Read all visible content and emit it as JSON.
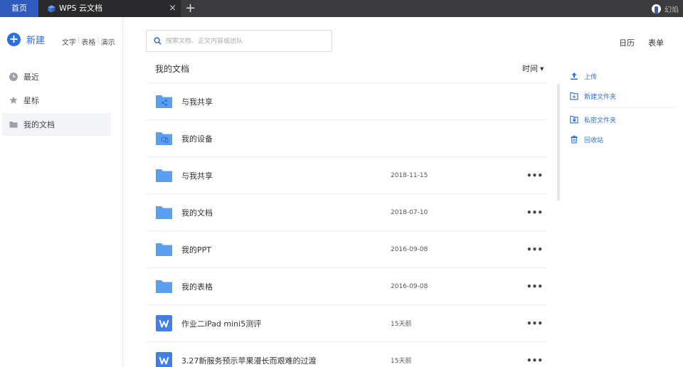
{
  "tabs": {
    "home": "首页",
    "doc": "WPS 云文档",
    "close": "×",
    "add": "+"
  },
  "user": {
    "name": "幻焰"
  },
  "sidebar": {
    "new_label": "新建",
    "quick": [
      "文字",
      "表格",
      "演示"
    ],
    "items": [
      {
        "label": "最近",
        "icon": "clock-icon"
      },
      {
        "label": "星标",
        "icon": "star-icon"
      },
      {
        "label": "我的文档",
        "icon": "folder-icon",
        "active": true
      }
    ]
  },
  "search": {
    "placeholder": "搜索文档、正文内容或团队"
  },
  "header_links": {
    "calendar": "日历",
    "form": "表单"
  },
  "main": {
    "title": "我的文档",
    "sort_label": "时间",
    "files": [
      {
        "name": "与我共享",
        "date": "",
        "type": "shared-folder",
        "more": ""
      },
      {
        "name": "我的设备",
        "date": "",
        "type": "device-folder",
        "more": ""
      },
      {
        "name": "与我共享",
        "date": "2018-11-15",
        "type": "folder",
        "more": "•••"
      },
      {
        "name": "我的文档",
        "date": "2018-07-10",
        "type": "folder",
        "more": "•••"
      },
      {
        "name": "我的PPT",
        "date": "2016-09-08",
        "type": "folder",
        "more": "•••"
      },
      {
        "name": "我的表格",
        "date": "2016-09-08",
        "type": "folder",
        "more": "•••"
      },
      {
        "name": "作业二iPad mini5测评",
        "date": "15天前",
        "type": "wps-doc",
        "more": "•••"
      },
      {
        "name": "3.27新服务预示苹果漫长而艰难的过渡",
        "date": "15天前",
        "type": "wps-doc",
        "more": "•••"
      }
    ]
  },
  "actions": {
    "upload": "上传",
    "new_folder": "新建文件夹",
    "private_folder": "私密文件夹",
    "recycle_bin": "回收站"
  },
  "colors": {
    "accent": "#2b6fe0",
    "folder": "#5aa0f0",
    "active_tab": "#2e5bbd"
  }
}
